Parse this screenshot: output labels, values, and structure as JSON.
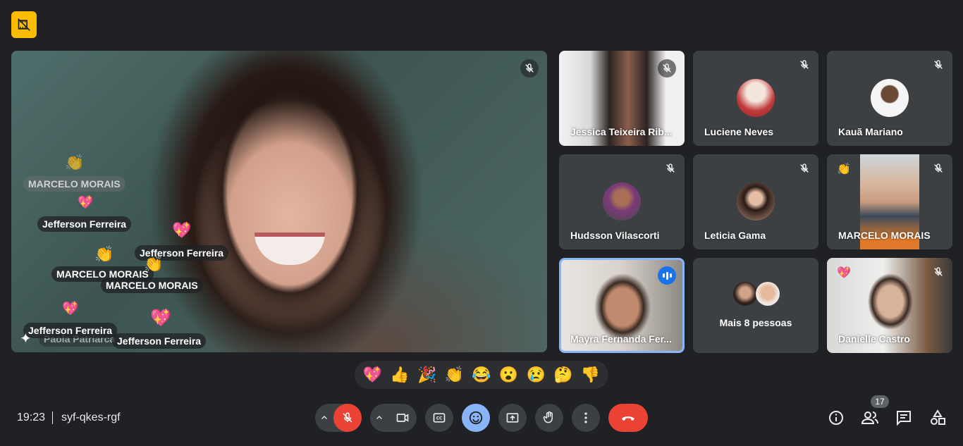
{
  "main_speaker": {
    "reactions": [
      {
        "name": "MARCELO MORAIS",
        "emoji": "👏"
      },
      {
        "name": "Jefferson Ferreira",
        "emoji": "💖"
      },
      {
        "name": "Jefferson Ferreira",
        "emoji": "💖"
      },
      {
        "name": "MARCELO MORAIS",
        "emoji": "👏"
      },
      {
        "name": "MARCELO MORAIS",
        "emoji": "👏"
      },
      {
        "name": "Jefferson Ferreira",
        "emoji": "💖"
      },
      {
        "name": "Jefferson Ferreira",
        "emoji": "💖"
      },
      {
        "name": "Paola Patriarca",
        "emoji": ""
      }
    ]
  },
  "participants": [
    {
      "name": "Jessica Teixeira Rib...",
      "muted": true
    },
    {
      "name": "Luciene Neves",
      "muted": true
    },
    {
      "name": "Kauã Mariano",
      "muted": true
    },
    {
      "name": "Hudsson Vilascorti",
      "muted": true
    },
    {
      "name": "Leticia Gama",
      "muted": true
    },
    {
      "name": "MARCELO MORAIS",
      "muted": true,
      "reaction": "👏"
    },
    {
      "name": "Mayra Fernanda Fer...",
      "speaking": true
    },
    {
      "name": "Mais 8 pessoas"
    },
    {
      "name": "Danielle Castro",
      "muted": true,
      "reaction": "💖"
    }
  ],
  "reaction_bar": [
    "💖",
    "👍",
    "🎉",
    "👏",
    "😂",
    "😮",
    "😢",
    "🤔",
    "👎"
  ],
  "meeting": {
    "time": "19:23",
    "code": "syf-qkes-rgf"
  },
  "people_count": "17",
  "colors": {
    "background": "#202124",
    "tile": "#3c4043",
    "end_call": "#ea4335",
    "accent": "#8ab4f8",
    "badge": "#fbbc04"
  }
}
